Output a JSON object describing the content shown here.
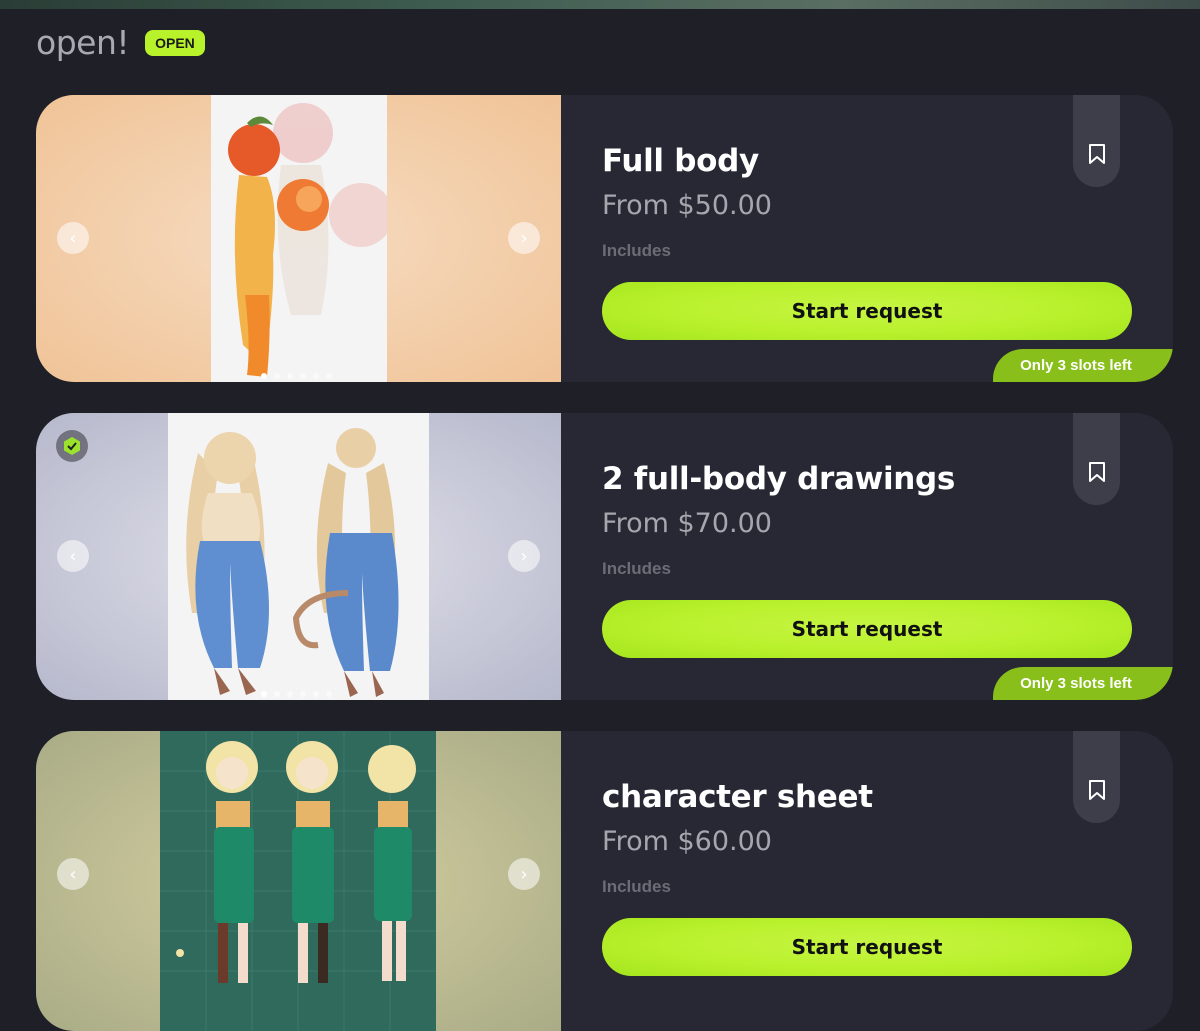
{
  "section": {
    "title": "open!",
    "badge": "OPEN"
  },
  "cards": [
    {
      "title": "Full body",
      "price": "From $50.00",
      "includes_label": "Includes",
      "button_label": "Start request",
      "slots_badge": "Only 3 slots left",
      "gallery_background": "#f1c79f",
      "verified": false
    },
    {
      "title": "2 full-body drawings",
      "price": "From $70.00",
      "includes_label": "Includes",
      "button_label": "Start request",
      "slots_badge": "Only 3 slots left",
      "gallery_background": "#c2c3d4",
      "verified": true
    },
    {
      "title": "character sheet",
      "price": "From $60.00",
      "includes_label": "Includes",
      "button_label": "Start request",
      "slots_badge": "",
      "gallery_background": "#b1b18c",
      "verified": false
    }
  ],
  "colors": {
    "page_background": "#1f1f27",
    "card_background": "#282834",
    "accent_lime": "#b8f22a",
    "slots_green": "#88bf1b"
  },
  "icons": {
    "bookmark": "bookmark-icon",
    "prev": "chevron-left-icon",
    "next": "chevron-right-icon",
    "verified": "verified-check-icon"
  }
}
